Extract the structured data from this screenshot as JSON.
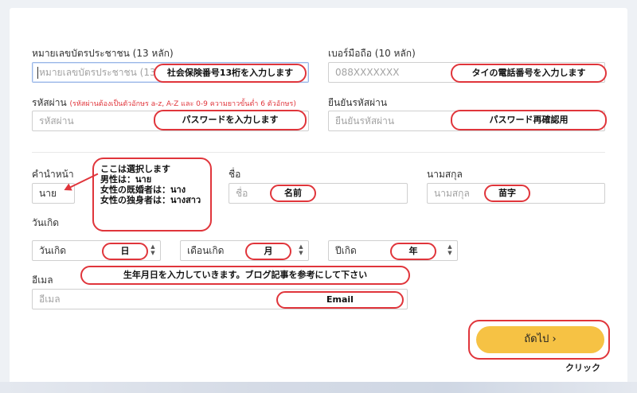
{
  "form": {
    "id_label": "หมายเลขบัตรประชาชน (13 หลัก)",
    "id_placeholder": "หมายเลขบัตรประชาชน (13 หลัก)",
    "phone_label": "เบอร์มือถือ (10 หลัก)",
    "phone_placeholder": "088XXXXXXX",
    "password_label": "รหัสผ่าน",
    "password_hint": "(รหัสผ่านต้องเป็นตัวอักษร a-z, A-Z และ 0-9 ความยาวขั้นต่ำ 6 ตัวอักษร)",
    "password_placeholder": "รหัสผ่าน",
    "confirm_label": "ยืนยันรหัสผ่าน",
    "confirm_placeholder": "ยืนยันรหัสผ่าน",
    "title_label": "คำนำหน้า",
    "title_value": "นาย",
    "firstname_label": "ชื่อ",
    "firstname_placeholder": "ชื่อ",
    "lastname_label": "นามสกุล",
    "lastname_placeholder": "นามสกุล",
    "birth_label": "วันเกิด",
    "day_value": "วันเกิด",
    "month_value": "เดือนเกิด",
    "year_value": "ปีเกิด",
    "email_label": "อีเมล",
    "email_placeholder": "อีเมล",
    "next_button": "ถัดไป ›"
  },
  "annotations": {
    "id": "社会保険番号13桁を入力します",
    "phone": "タイの電話番号を入力します",
    "password": "パスワードを入力します",
    "confirm": "パスワード再確認用",
    "title_lines": [
      "ここは選択します",
      "男性は：นาย",
      "女性の既婚者は：นาง",
      "女性の独身者は：นางสาว"
    ],
    "firstname": "名前",
    "lastname": "苗字",
    "day": "日",
    "month": "月",
    "year": "年",
    "birth": "生年月日を入力していきます。ブログ記事を参考にして下さい",
    "email": "Email",
    "click": "クリック"
  },
  "icons": {
    "select_arrows": "up-down-arrows-icon"
  },
  "colors": {
    "accent_red": "#e0353b",
    "button_yellow": "#f6c244"
  }
}
